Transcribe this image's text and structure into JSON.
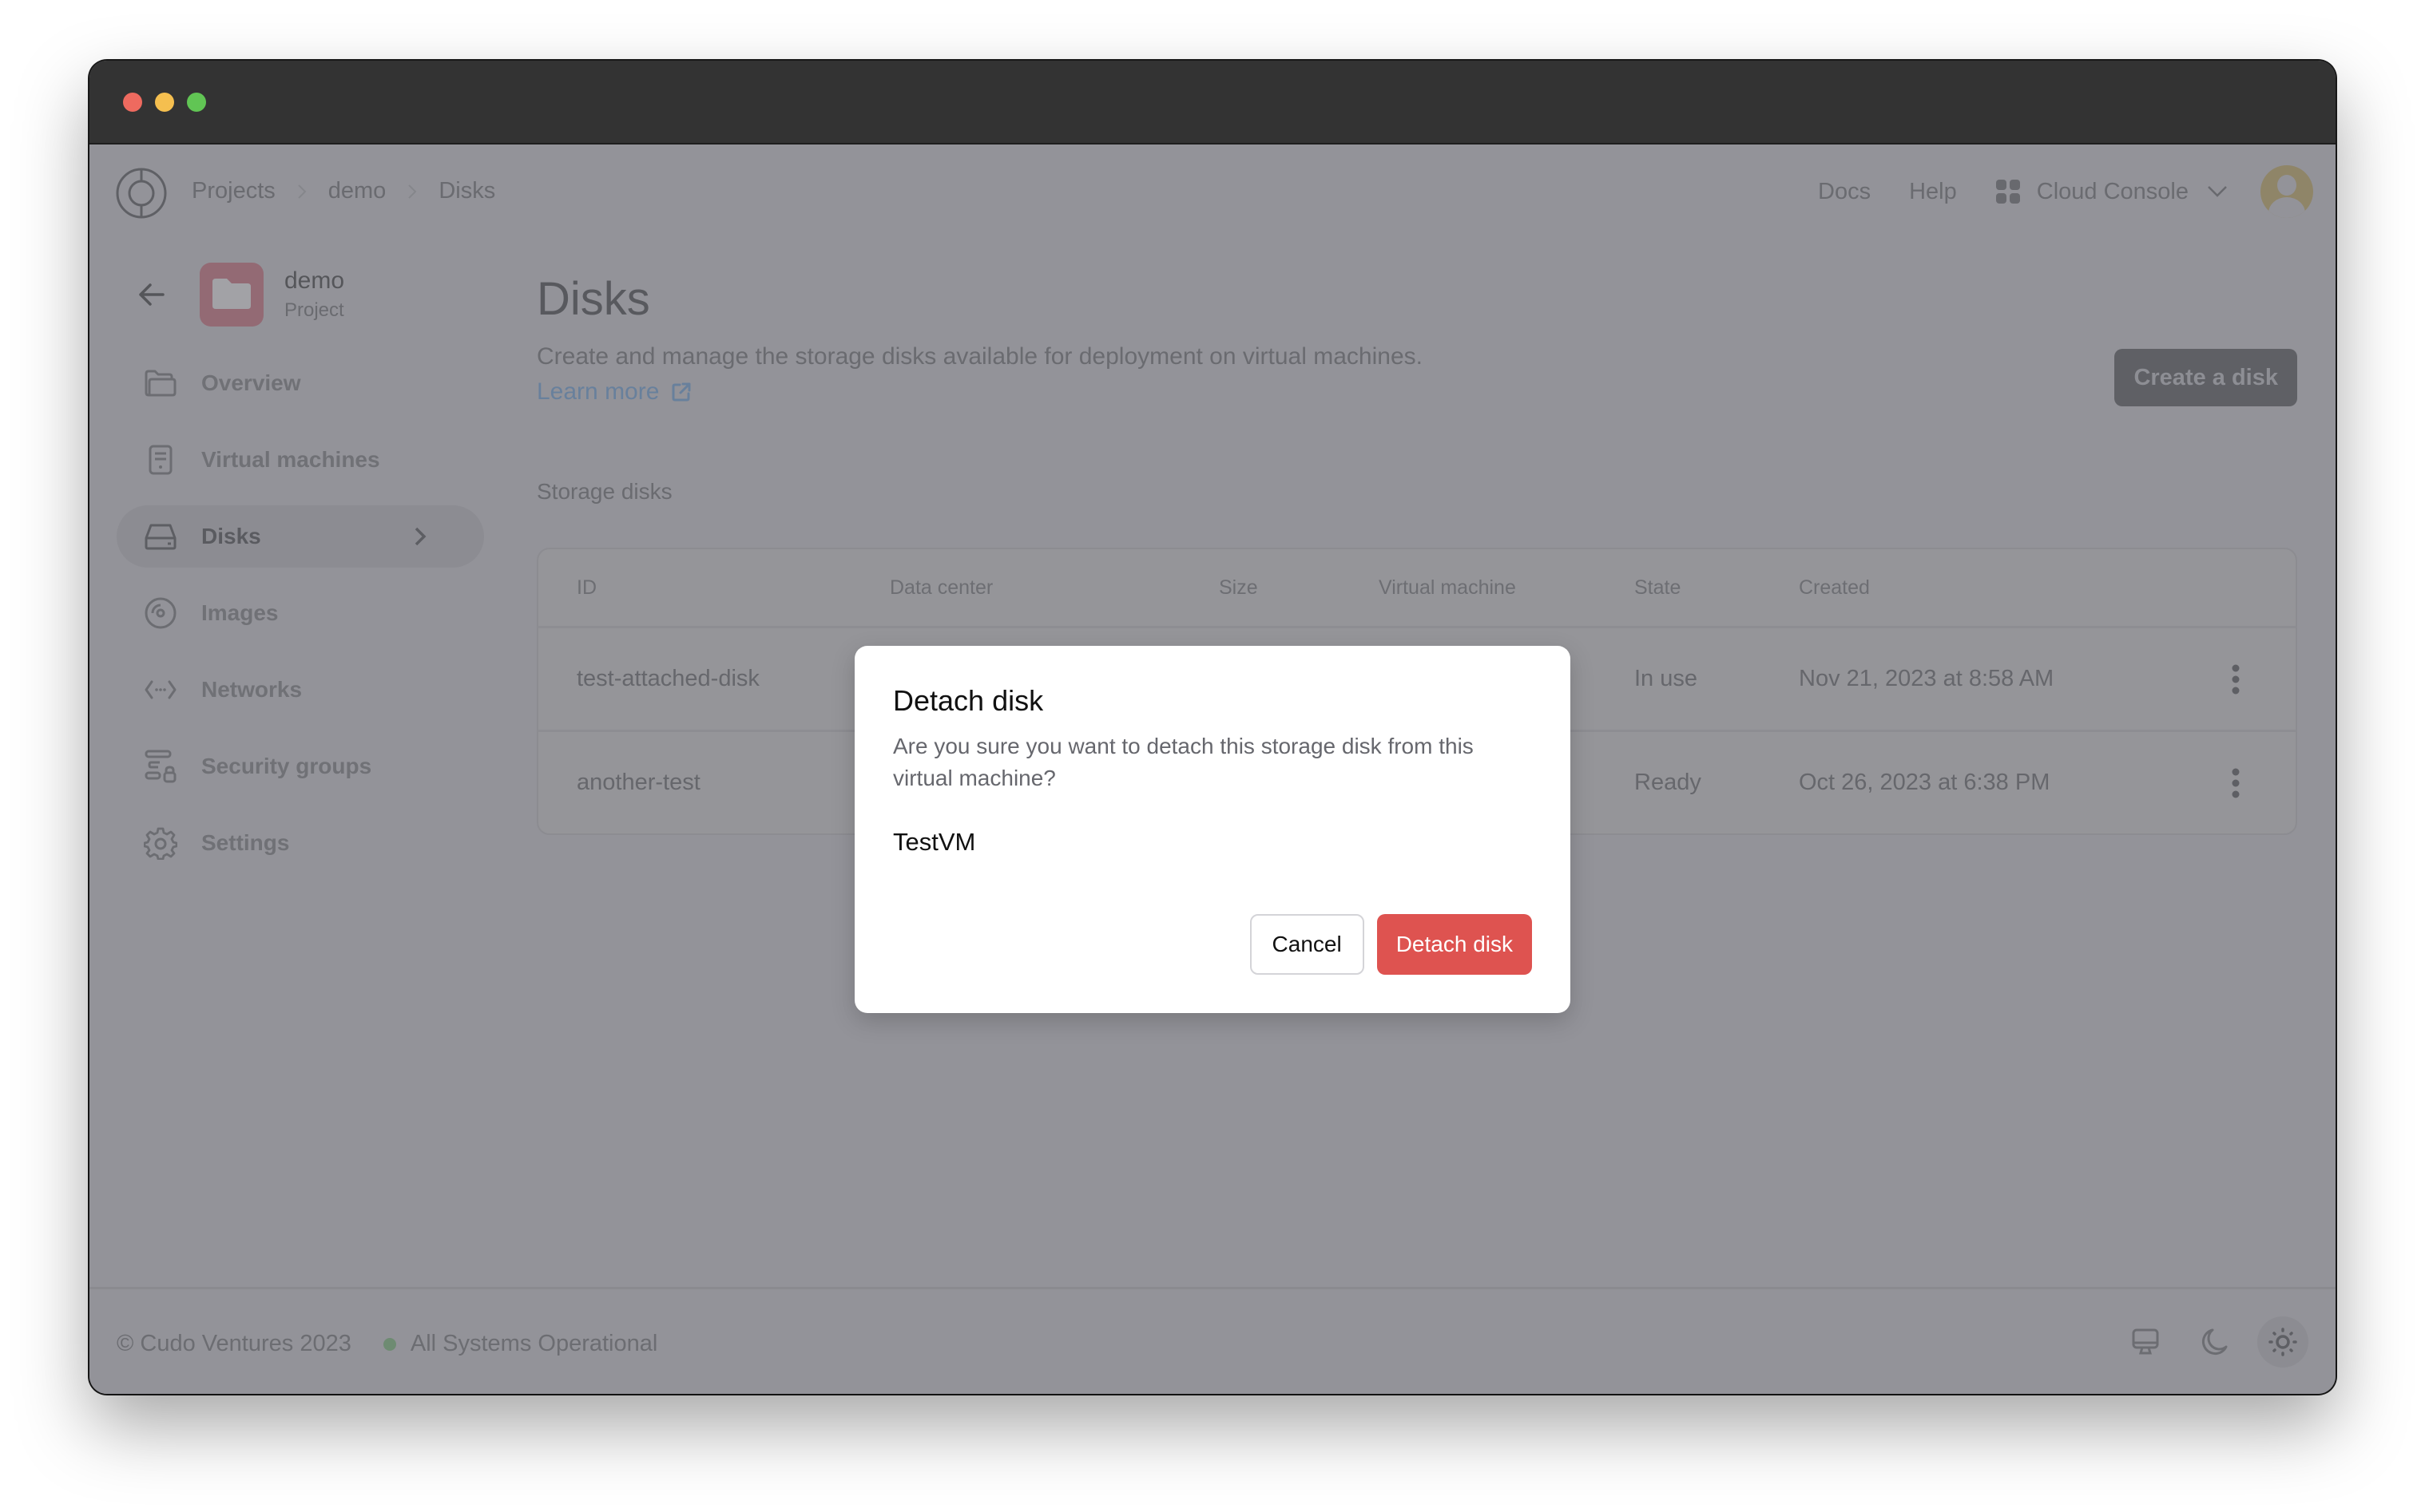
{
  "window": {
    "traffic_lights": [
      "close",
      "minimize",
      "maximize"
    ]
  },
  "topnav": {
    "logo_icon": "cudo-logo-icon",
    "breadcrumb": [
      "Projects",
      "demo",
      "Disks"
    ],
    "links": [
      "Docs",
      "Help"
    ],
    "console_label": "Cloud Console",
    "avatar_icon": "user-avatar-icon"
  },
  "sidebar": {
    "project_name": "demo",
    "project_subtitle": "Project",
    "items": [
      {
        "label": "Overview",
        "icon": "folder-open-icon"
      },
      {
        "label": "Virtual machines",
        "icon": "server-icon"
      },
      {
        "label": "Disks",
        "icon": "hard-drive-icon",
        "active": true
      },
      {
        "label": "Images",
        "icon": "disc-icon"
      },
      {
        "label": "Networks",
        "icon": "network-code-icon"
      },
      {
        "label": "Security groups",
        "icon": "security-list-lock-icon"
      },
      {
        "label": "Settings",
        "icon": "gear-icon"
      }
    ]
  },
  "main": {
    "title": "Disks",
    "description": "Create and manage the storage disks available for deployment on virtual machines.",
    "learn_more": "Learn more",
    "create_button": "Create a disk",
    "section_label": "Storage disks",
    "table": {
      "columns": [
        "ID",
        "Data center",
        "Size",
        "Virtual machine",
        "State",
        "Created"
      ],
      "rows": [
        {
          "id": "test-attached-disk",
          "state": "In use",
          "created": "Nov 21, 2023 at 8:58 AM"
        },
        {
          "id": "another-test",
          "state": "Ready",
          "created": "Oct 26, 2023 at 6:38 PM"
        }
      ]
    }
  },
  "footer": {
    "copyright": "© Cudo Ventures 2023",
    "status": "All Systems Operational",
    "status_color": "#6e8b72",
    "theme_options": [
      "system",
      "dark",
      "light"
    ],
    "theme_selected": "light"
  },
  "modal": {
    "title": "Detach disk",
    "body": "Are you sure you want to detach this storage disk from this virtual machine?",
    "vm_name": "TestVM",
    "cancel_label": "Cancel",
    "confirm_label": "Detach disk",
    "confirm_color": "#de5350"
  }
}
